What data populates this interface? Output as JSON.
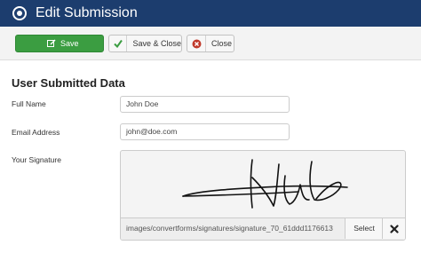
{
  "header": {
    "title": "Edit Submission",
    "background": "#1c3d6e",
    "icon": "circle-dot-icon"
  },
  "toolbar": {
    "save_label": "Save",
    "save_close_label": "Save & Close",
    "close_label": "Close",
    "save_color": "#3b9d41",
    "icons": {
      "save": "pencil-square-icon",
      "save_close": "check-icon",
      "close": "x-circle-icon"
    }
  },
  "section": {
    "title": "User Submitted Data"
  },
  "fields": {
    "full_name": {
      "label": "Full Name",
      "value": "John Doe"
    },
    "email": {
      "label": "Email Address",
      "value": "john@doe.com"
    },
    "signature": {
      "label": "Your Signature",
      "path": "images/convertforms/signatures/signature_70_61ddd1176613",
      "select_label": "Select",
      "clear_icon": "x-icon"
    }
  }
}
